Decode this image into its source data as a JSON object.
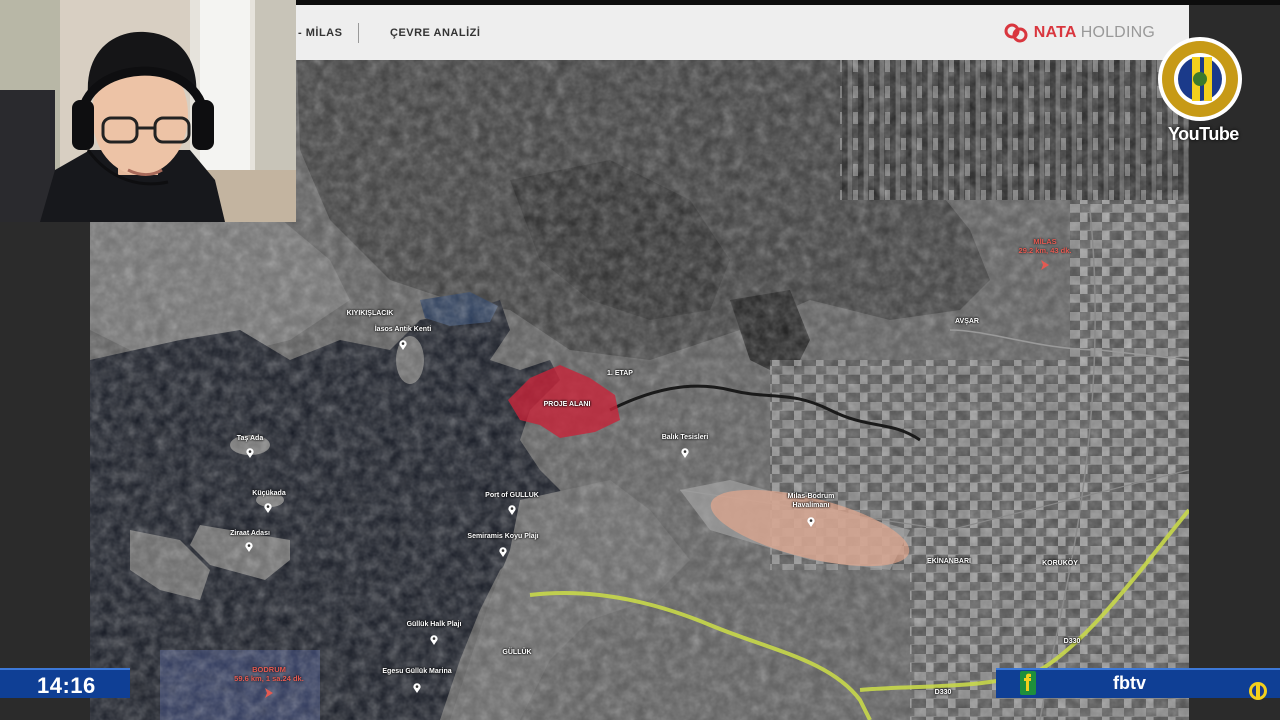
{
  "header": {
    "nav_left": "- MİLAS",
    "nav_right": "ÇEVRE ANALİZİ",
    "logo_brand": "NATA",
    "logo_suffix": "HOLDING"
  },
  "map": {
    "labels": {
      "kiyikislacik": "KIYIKIŞLACIK",
      "iasos": "İasos Antik Kenti",
      "tas_ada": "Taş Ada",
      "kucukada": "Küçükada",
      "ziraat": "Ziraat Adası",
      "proje": "PROJE ALANI",
      "etap": "1. ETAP",
      "balik": "Balık Tesisleri",
      "port": "Port of GULLUK",
      "semiramis": "Semiramis Koyu Plajı",
      "gulluk_halk": "Güllük Halk Plajı",
      "gulluk": "GÜLLÜK",
      "egesu": "Egesu Güllük Marina",
      "airport_line1": "Milas-Bodrum",
      "airport_line2": "Havalimanı",
      "avsar": "AVŞAR",
      "koruköy": "KORUKÖY",
      "ekinanbari": "EKİNANBARI",
      "d330_a": "D330",
      "d330_b": "D330",
      "milas_name": "MİLAS",
      "milas_dist": "29.2 km, 43 dk.",
      "bodrum_name": "BODRUM",
      "bodrum_dist": "59.6 km, 1 sa.24 dk."
    }
  },
  "overlay": {
    "clock": "14:16",
    "channel": "fbtv",
    "platform": "YouTube"
  },
  "colors": {
    "accent_red": "#d9363e",
    "overlay_blue": "#0f3f95",
    "highway_yellow": "#c8d84a"
  }
}
